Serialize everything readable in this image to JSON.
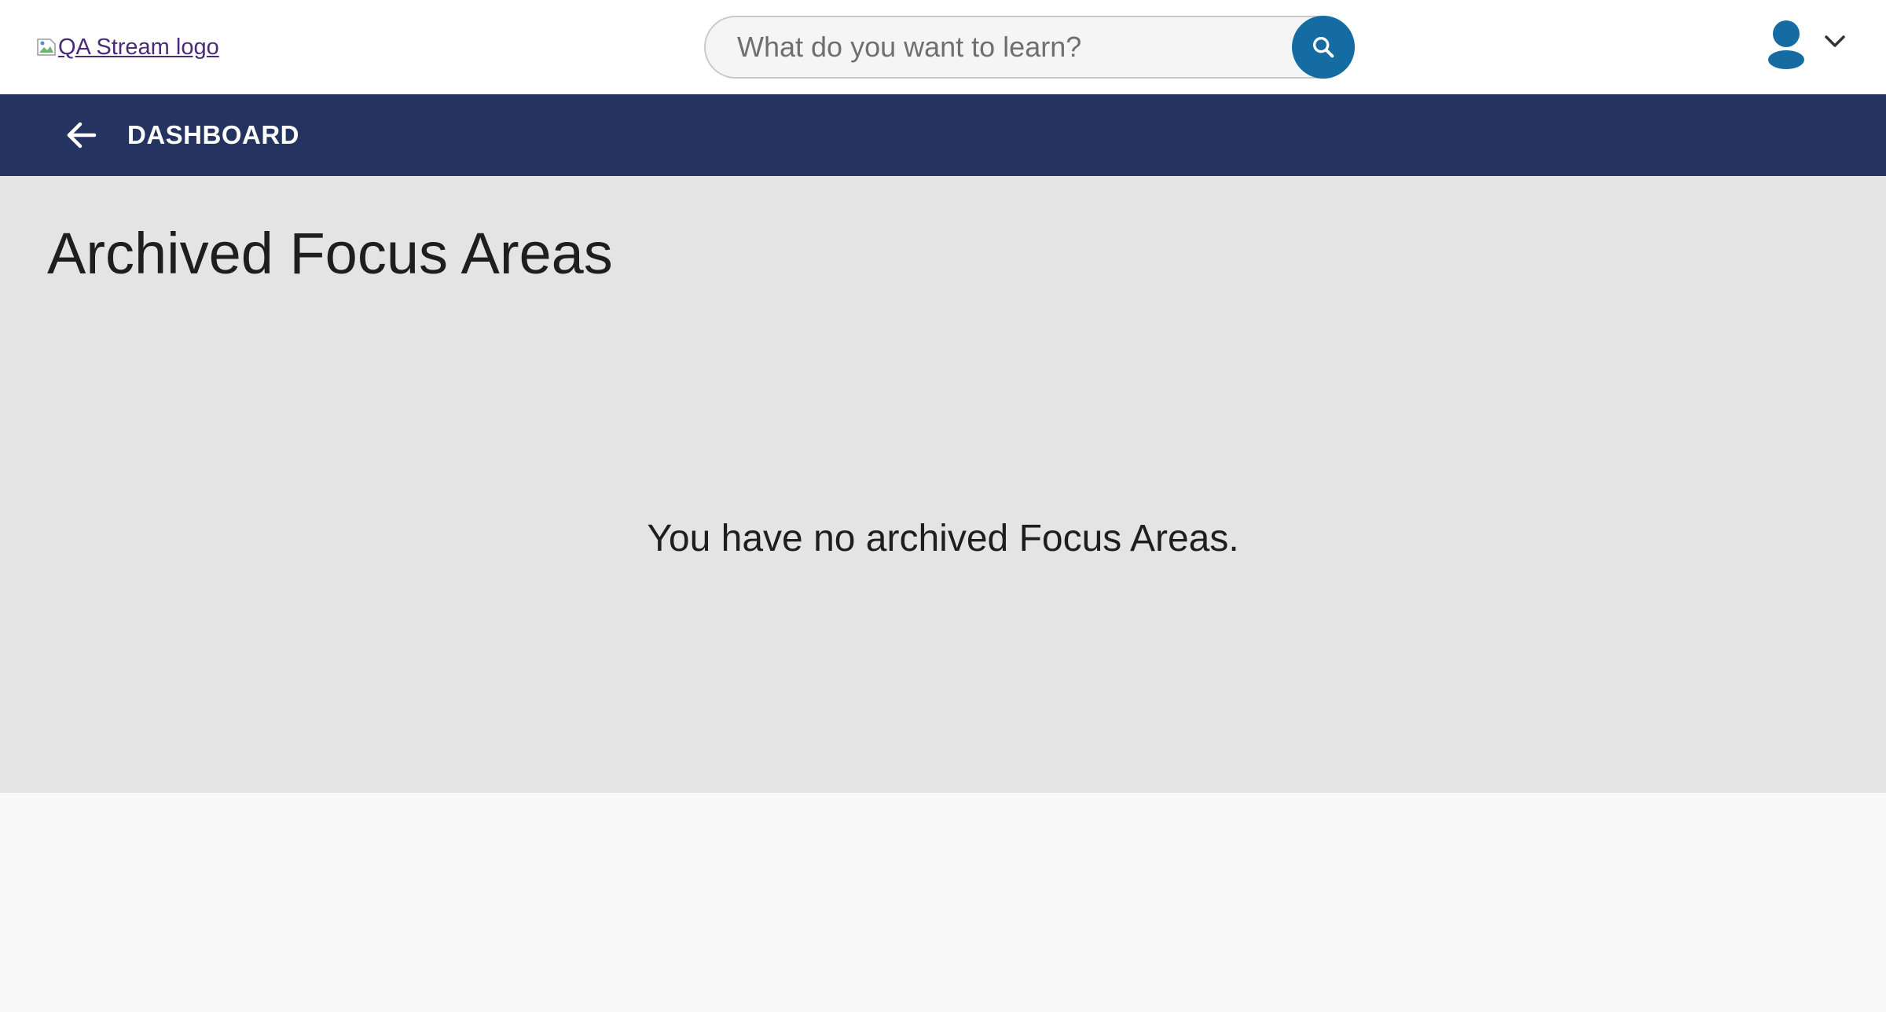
{
  "header": {
    "logo_alt": "QA Stream logo",
    "search": {
      "placeholder": "What do you want to learn?",
      "value": ""
    },
    "icons": {
      "search": "search-icon",
      "user": "user-avatar-icon",
      "menu": "chevron-down-icon"
    },
    "colors": {
      "search_button": "#146ca3",
      "avatar": "#146ca3"
    }
  },
  "nav": {
    "back_label": "DASHBOARD",
    "back_icon": "arrow-left-icon",
    "background": "#24335f"
  },
  "main": {
    "title": "Archived Focus Areas",
    "empty_message": "You have no archived Focus Areas."
  }
}
